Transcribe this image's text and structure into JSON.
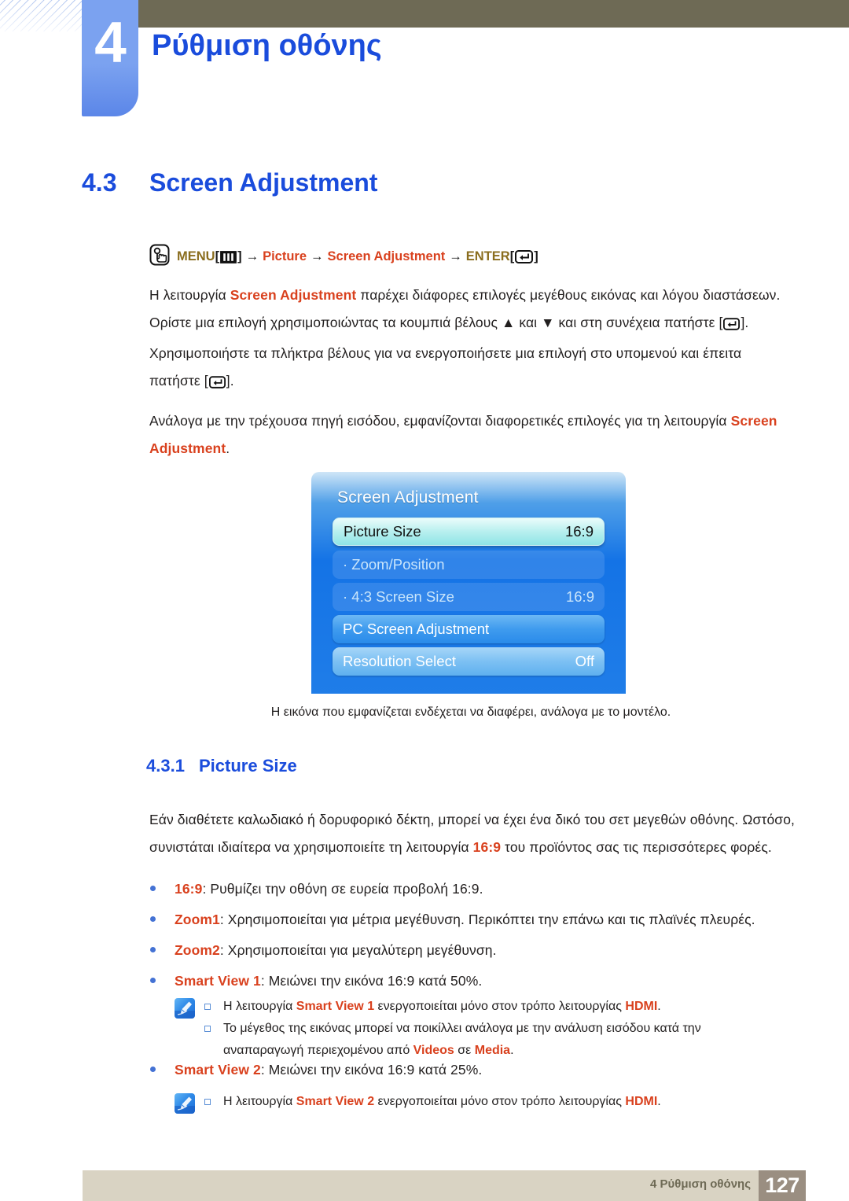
{
  "chapter": {
    "number": "4",
    "title": "Ρύθμιση οθόνης"
  },
  "section": {
    "number": "4.3",
    "title": "Screen Adjustment"
  },
  "menu_path": {
    "hand_icon": "hand-press-icon",
    "menu_label": "MENU",
    "menu_icon": "menu-bars-icon",
    "arrow1": "→",
    "picture_label": "Picture",
    "arrow2": "→",
    "screen_adjustment_label": "Screen Adjustment",
    "arrow3": "→",
    "enter_label": "ENTER",
    "enter_icon": "enter-key-icon",
    "bracket_open": "[",
    "bracket_close": "]"
  },
  "paragraphs": {
    "p1_a": "Η λειτουργία ",
    "p1_b": "Screen Adjustment",
    "p1_c": " παρέχει διάφορες επιλογές μεγέθους εικόνας και λόγου διαστάσεων. Ορίστε μια επιλογή χρησιμοποιώντας τα κουμπιά βέλους ",
    "p1_up": "▲",
    "p1_d": " και ",
    "p1_down": "▼",
    "p1_e": " και στη συνέχεια πατήστε [",
    "p1_f": "]. Χρησιμοποιήστε τα πλήκτρα βέλους για να ενεργοποιήσετε μια επιλογή στο υπομενού και έπειτα πατήστε [",
    "p1_g": "].",
    "p2_a": "Ανάλογα με την τρέχουσα πηγή εισόδου, εμφανίζονται διαφορετικές επιλογές για τη λειτουργία ",
    "p2_b": "Screen Adjustment",
    "p2_c": "."
  },
  "osd": {
    "title": "Screen Adjustment",
    "rows": [
      {
        "label": "Picture Size",
        "value": "16:9",
        "style": "selected"
      },
      {
        "label": "· Zoom/Position",
        "value": "",
        "style": "sub"
      },
      {
        "label": "· 4:3 Screen Size",
        "value": "16:9",
        "style": "sub"
      },
      {
        "label": "PC Screen Adjustment",
        "value": "",
        "style": "normal"
      },
      {
        "label": "Resolution Select",
        "value": "Off",
        "style": "normal2"
      }
    ]
  },
  "caption": "Η εικόνα που εμφανίζεται ενδέχεται να διαφέρει, ανάλογα με το μοντέλο.",
  "subsection": {
    "number": "4.3.1",
    "title": "Picture Size"
  },
  "paragraph3": {
    "a": "Εάν διαθέτετε καλωδιακό ή δορυφορικό δέκτη, μπορεί να έχει ένα δικό του σετ μεγεθών οθόνης. Ωστόσο, συνιστάται ιδιαίτερα να χρησιμοποιείτε τη λειτουργία ",
    "b": "16:9",
    "c": " του προϊόντος σας τις περισσότερες φορές."
  },
  "bullets": [
    {
      "term": "16:9",
      "rest": ": Ρυθμίζει την οθόνη σε ευρεία προβολή 16:9."
    },
    {
      "term": "Zoom1",
      "rest": ": Χρησιμοποιείται για μέτρια μεγέθυνση. Περικόπτει την επάνω και τις πλαϊνές πλευρές."
    },
    {
      "term": "Zoom2",
      "rest": ": Χρησιμοποιείται για μεγαλύτερη μεγέθυνση."
    },
    {
      "term": "Smart View 1",
      "rest": ": Μειώνει την εικόνα 16:9 κατά 50%."
    },
    {
      "term": "Smart View 2",
      "rest": ": Μειώνει την εικόνα 16:9 κατά 25%."
    }
  ],
  "note1": {
    "icon": "note-pen-icon",
    "item1_a": "Η λειτουργία ",
    "item1_b": "Smart View 1",
    "item1_c": " ενεργοποιείται μόνο στον τρόπο λειτουργίας ",
    "item1_d": "HDMI",
    "item1_e": ".",
    "item2_a": "Το μέγεθος της εικόνας μπορεί να ποικίλλει ανάλογα με την ανάλυση εισόδου κατά την αναπαραγωγή περιεχομένου από ",
    "item2_b": "Videos",
    "item2_c": " σε ",
    "item2_d": "Media",
    "item2_e": "."
  },
  "note2": {
    "icon": "note-pen-icon",
    "item1_a": "Η λειτουργία ",
    "item1_b": "Smart View 2",
    "item1_c": " ενεργοποιείται μόνο στον τρόπο λειτουργίας ",
    "item1_d": "HDMI",
    "item1_e": "."
  },
  "footer": {
    "text": "4 Ρύθμιση οθόνης",
    "page": "127"
  },
  "colors": {
    "accent_blue": "#1a4cdc",
    "accent_red": "#d9411e",
    "gold": "#8a6d1e",
    "olive": "#6e6a55",
    "footer_bar": "#d9d3c3",
    "page_box": "#9a8e81",
    "tab_blue": "#7ba2f0"
  }
}
